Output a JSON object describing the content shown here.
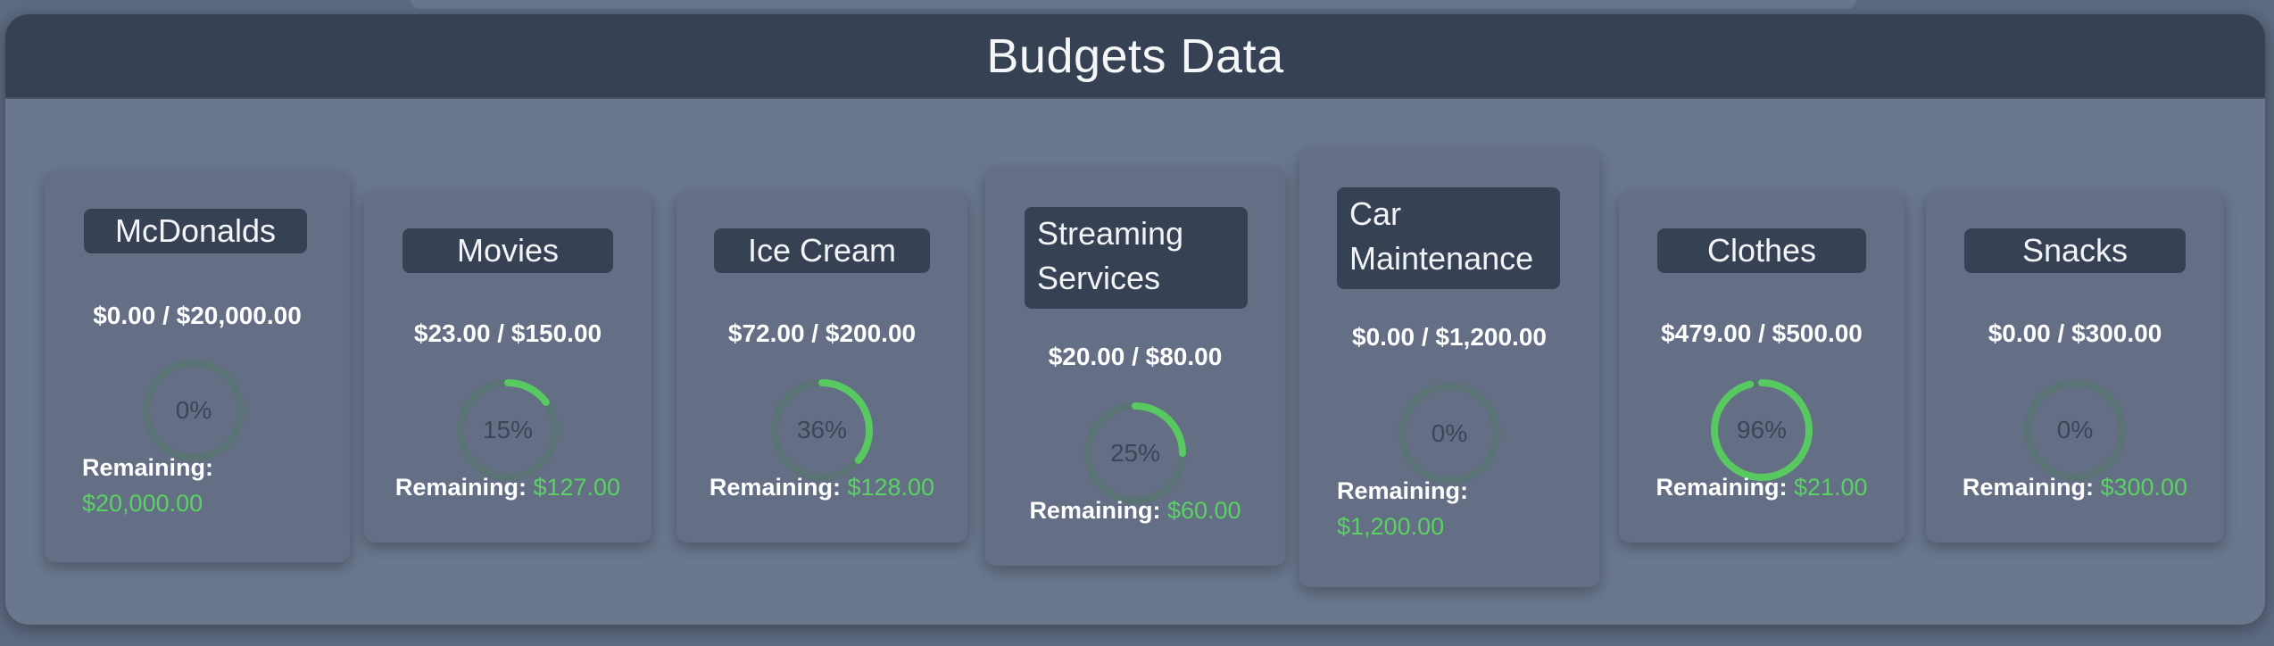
{
  "header": {
    "title": "Budgets Data"
  },
  "colors": {
    "progress": "#58c961",
    "track": "#5a7374",
    "remaining_value": "#59d163"
  },
  "budgets": [
    {
      "title": "McDonalds",
      "amount": "$0.00 / $20,000.00",
      "percent": 0,
      "percent_label": "0%",
      "remaining_label": "Remaining:",
      "remaining_value": "$20,000.00"
    },
    {
      "title": "Movies",
      "amount": "$23.00 / $150.00",
      "percent": 15,
      "percent_label": "15%",
      "remaining_label": "Remaining:",
      "remaining_value": "$127.00"
    },
    {
      "title": "Ice Cream",
      "amount": "$72.00 / $200.00",
      "percent": 36,
      "percent_label": "36%",
      "remaining_label": "Remaining:",
      "remaining_value": "$128.00"
    },
    {
      "title": "Streaming Services",
      "amount": "$20.00 / $80.00",
      "percent": 25,
      "percent_label": "25%",
      "remaining_label": "Remaining:",
      "remaining_value": "$60.00"
    },
    {
      "title": "Car Maintenance",
      "amount": "$0.00 / $1,200.00",
      "percent": 0,
      "percent_label": "0%",
      "remaining_label": "Remaining:",
      "remaining_value": "$1,200.00"
    },
    {
      "title": "Clothes",
      "amount": "$479.00 / $500.00",
      "percent": 96,
      "percent_label": "96%",
      "remaining_label": "Remaining:",
      "remaining_value": "$21.00"
    },
    {
      "title": "Snacks",
      "amount": "$0.00 / $300.00",
      "percent": 0,
      "percent_label": "0%",
      "remaining_label": "Remaining:",
      "remaining_value": "$300.00"
    }
  ]
}
